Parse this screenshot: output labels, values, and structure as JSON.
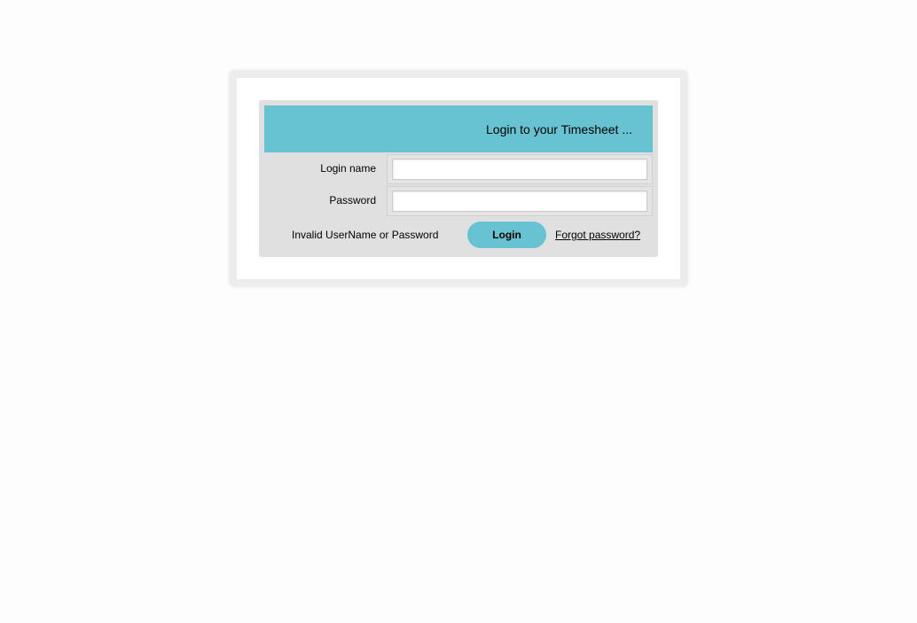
{
  "login": {
    "header_title": "Login to your Timesheet ...",
    "login_name_label": "Login name",
    "login_name_value": "",
    "password_label": "Password",
    "password_value": "",
    "error_message": "Invalid UserName or Password",
    "login_button_label": "Login",
    "forgot_password_link": "Forgot password?"
  },
  "colors": {
    "accent": "#67c3d1",
    "panel_background": "#e0e0e0",
    "page_background": "#fdfdfd"
  }
}
